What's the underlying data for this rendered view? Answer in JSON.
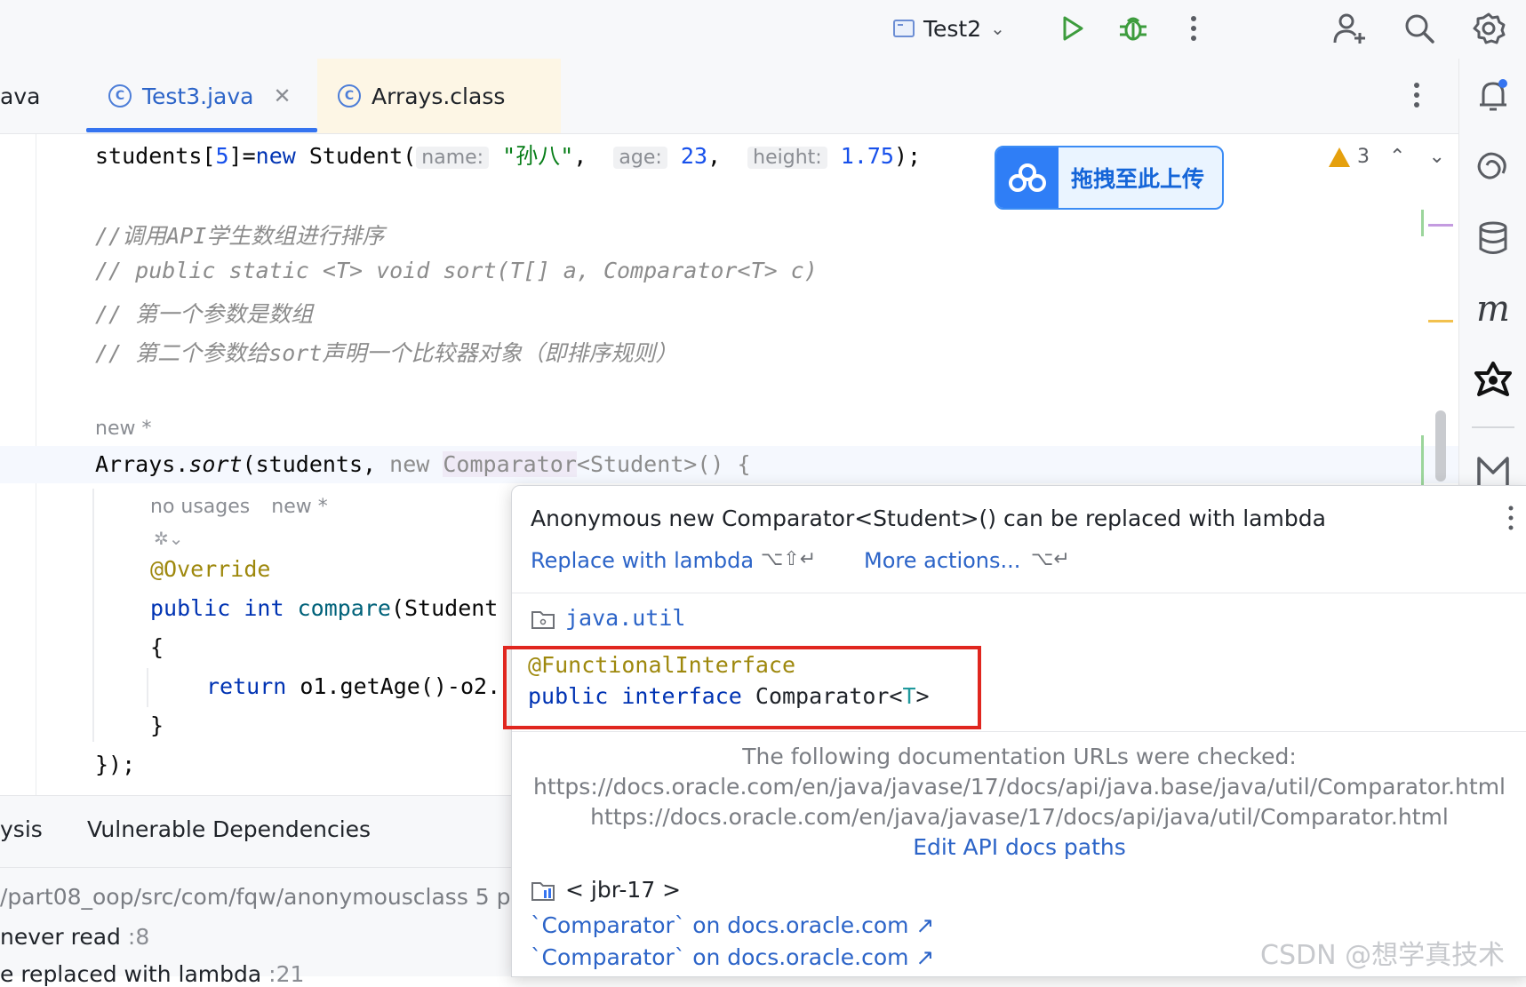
{
  "toolbar": {
    "run_config": "Test2",
    "icons": [
      "run-icon",
      "debug-icon",
      "more-icon",
      "add-user-icon",
      "search-icon",
      "settings-icon"
    ]
  },
  "tabs": [
    {
      "label": "ava",
      "active": false
    },
    {
      "label": "Test3.java",
      "active": true
    },
    {
      "label": "Arrays.class",
      "active": false
    }
  ],
  "editor": {
    "line1": {
      "prefix": "students[",
      "index": "5",
      "mid": "]=",
      "new": "new",
      "cls": " Student(",
      "hint_name": "name:",
      "name_val": "\"孙八\"",
      "comma1": ",",
      "hint_age": "age:",
      "age_val": "23",
      "comma2": ",",
      "hint_height": "height:",
      "height_val": "1.75",
      "end": ");"
    },
    "comments": [
      "//调用API学生数组进行排序",
      "// public static <T> void sort(T[] a, Comparator<T> c)",
      "// 第一个参数是数组",
      "// 第二个参数给sort声明一个比较器对象（即排序规则）"
    ],
    "author_hint": "new *",
    "sort_line": {
      "cls": "Arrays.",
      "meth": "sort",
      "args": "(students, ",
      "new": "new",
      "iface": "Comparator",
      "rest": "<Student>() {"
    },
    "usages_hint": "no usages",
    "usages_new": "new *",
    "override": "@Override",
    "compare_line": {
      "public": "public",
      "int": "int",
      "meth": "compare",
      "rest": "(Student"
    },
    "brace_open": "{",
    "return_line": {
      "kw": "return",
      "rest": " o1.getAge()-o2."
    },
    "brace_close": "}",
    "end_line": "});"
  },
  "upload_button": "拖拽至此上传",
  "warnings": {
    "count": "3"
  },
  "bottom_panel": {
    "tab_left": "ysis",
    "tab_vuln": "Vulnerable Dependencies",
    "path": "/part08_oop/src/com/fqw/anonymousclass",
    "path_count": "5 p",
    "item1": "never read",
    "item1_line": ":8",
    "item2": "e replaced with lambda",
    "item2_line": ":21"
  },
  "popup": {
    "title": "Anonymous new Comparator<Student>() can be replaced with lambda",
    "replace_action": "Replace with lambda",
    "replace_shortcut": "⌥⇧↵",
    "more_action": "More actions...",
    "more_shortcut": "⌥↵",
    "package": "java.util",
    "annotation": "@FunctionalInterface",
    "sig_public": "public",
    "sig_interface": "interface",
    "sig_name": "Comparator<",
    "sig_type": "T",
    "sig_end": ">",
    "doc_checked": "The following documentation URLs were checked:",
    "url1": "https://docs.oracle.com/en/java/javase/17/docs/api/java.base/java/util/Comparator.html",
    "url2": "https://docs.oracle.com/en/java/javase/17/docs/api/java/util/Comparator.html",
    "edit_paths": "Edit API docs paths",
    "jdk": "< jbr-17 >",
    "link1": "`Comparator` on docs.oracle.com ↗",
    "link2": "`Comparator` on docs.oracle.com ↗"
  },
  "watermark": "CSDN @想学真技术"
}
